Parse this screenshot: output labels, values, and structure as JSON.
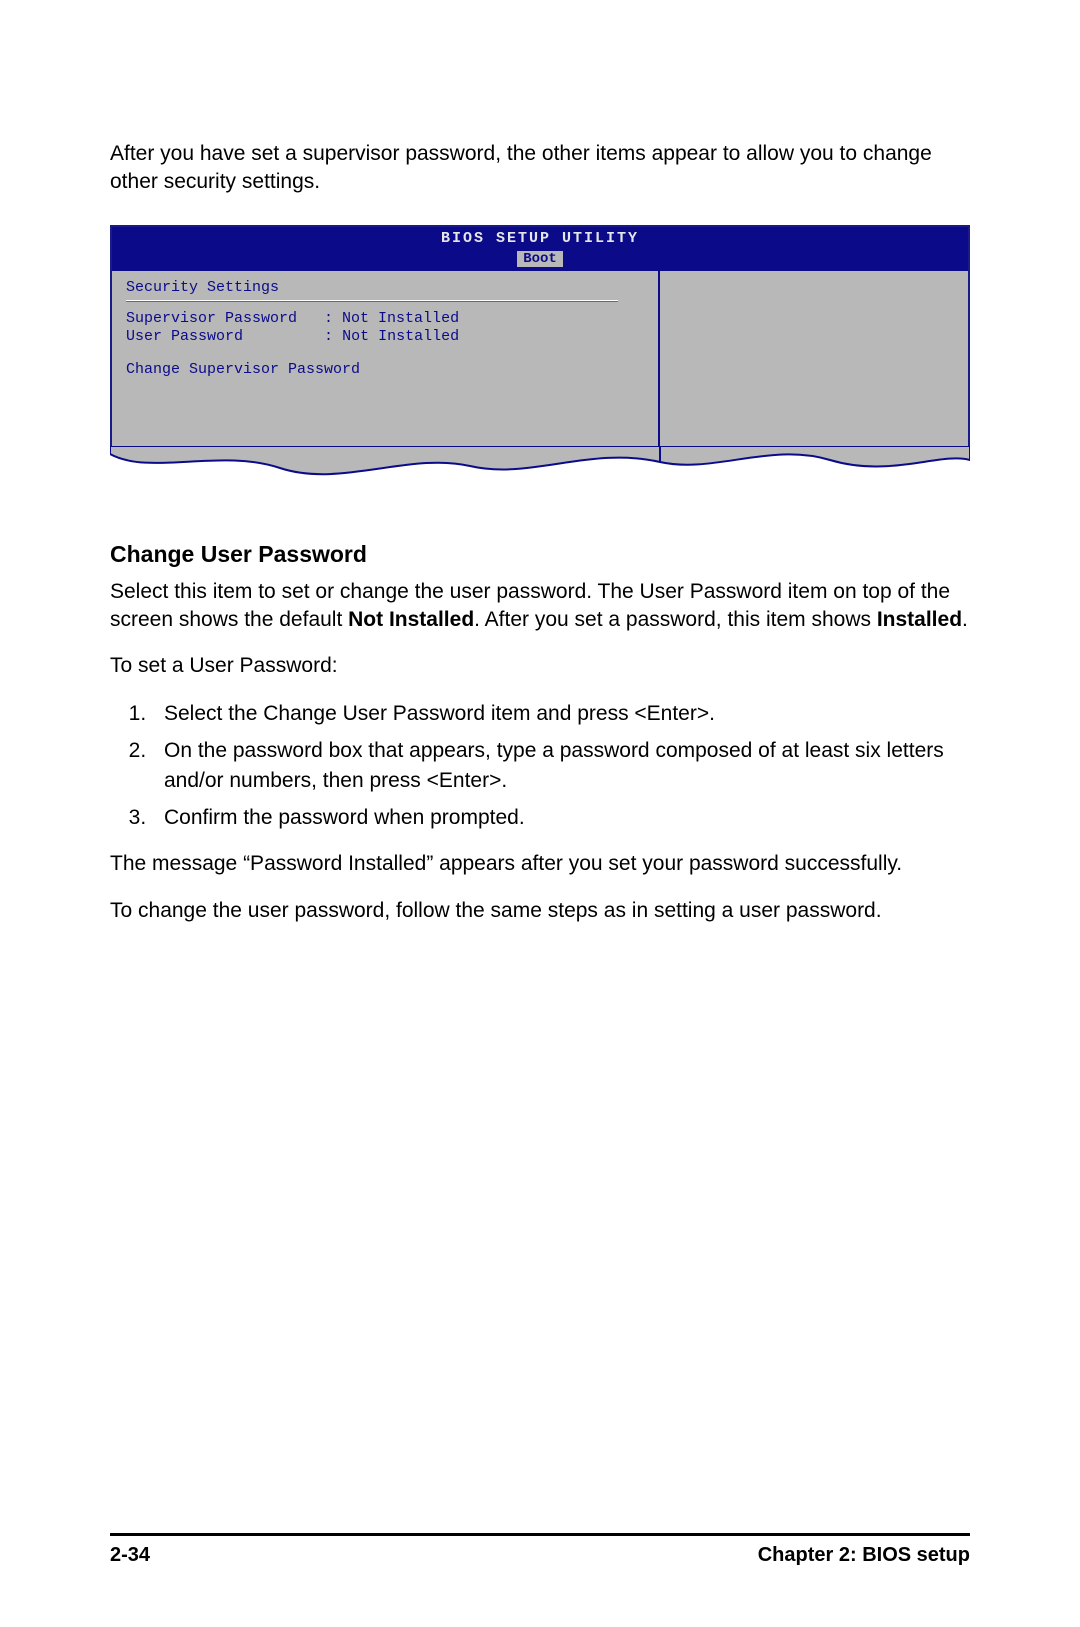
{
  "intro": "After you have set a supervisor password, the other items appear to allow you to change other security settings.",
  "bios": {
    "title": "BIOS SETUP UTILITY",
    "tab": "Boot",
    "section": "Security Settings",
    "rows": [
      {
        "label": "Supervisor Password",
        "value": "Not Installed"
      },
      {
        "label": "User Password",
        "value": "Not Installed"
      }
    ],
    "menu_item": "Change Supervisor Password"
  },
  "section_heading": "Change User Password",
  "para1_pre": "Select this item to set or change the user password. The User Password item on top of the screen shows the default ",
  "para1_bold1": "Not Installed",
  "para1_mid": ". After you set a password, this item shows ",
  "para1_bold2": "Installed",
  "para1_post": ".",
  "para2": "To set a User Password:",
  "steps": [
    "Select the Change User Password item and press <Enter>.",
    "On the password box that appears, type a password composed of at least six letters and/or numbers, then press <Enter>.",
    "Confirm the password when prompted."
  ],
  "para3": "The message “Password Installed” appears after you set your password successfully.",
  "para4": "To change the user password, follow the same steps as in setting a user password.",
  "footer": {
    "page": "2-34",
    "chapter": "Chapter 2: BIOS setup"
  }
}
